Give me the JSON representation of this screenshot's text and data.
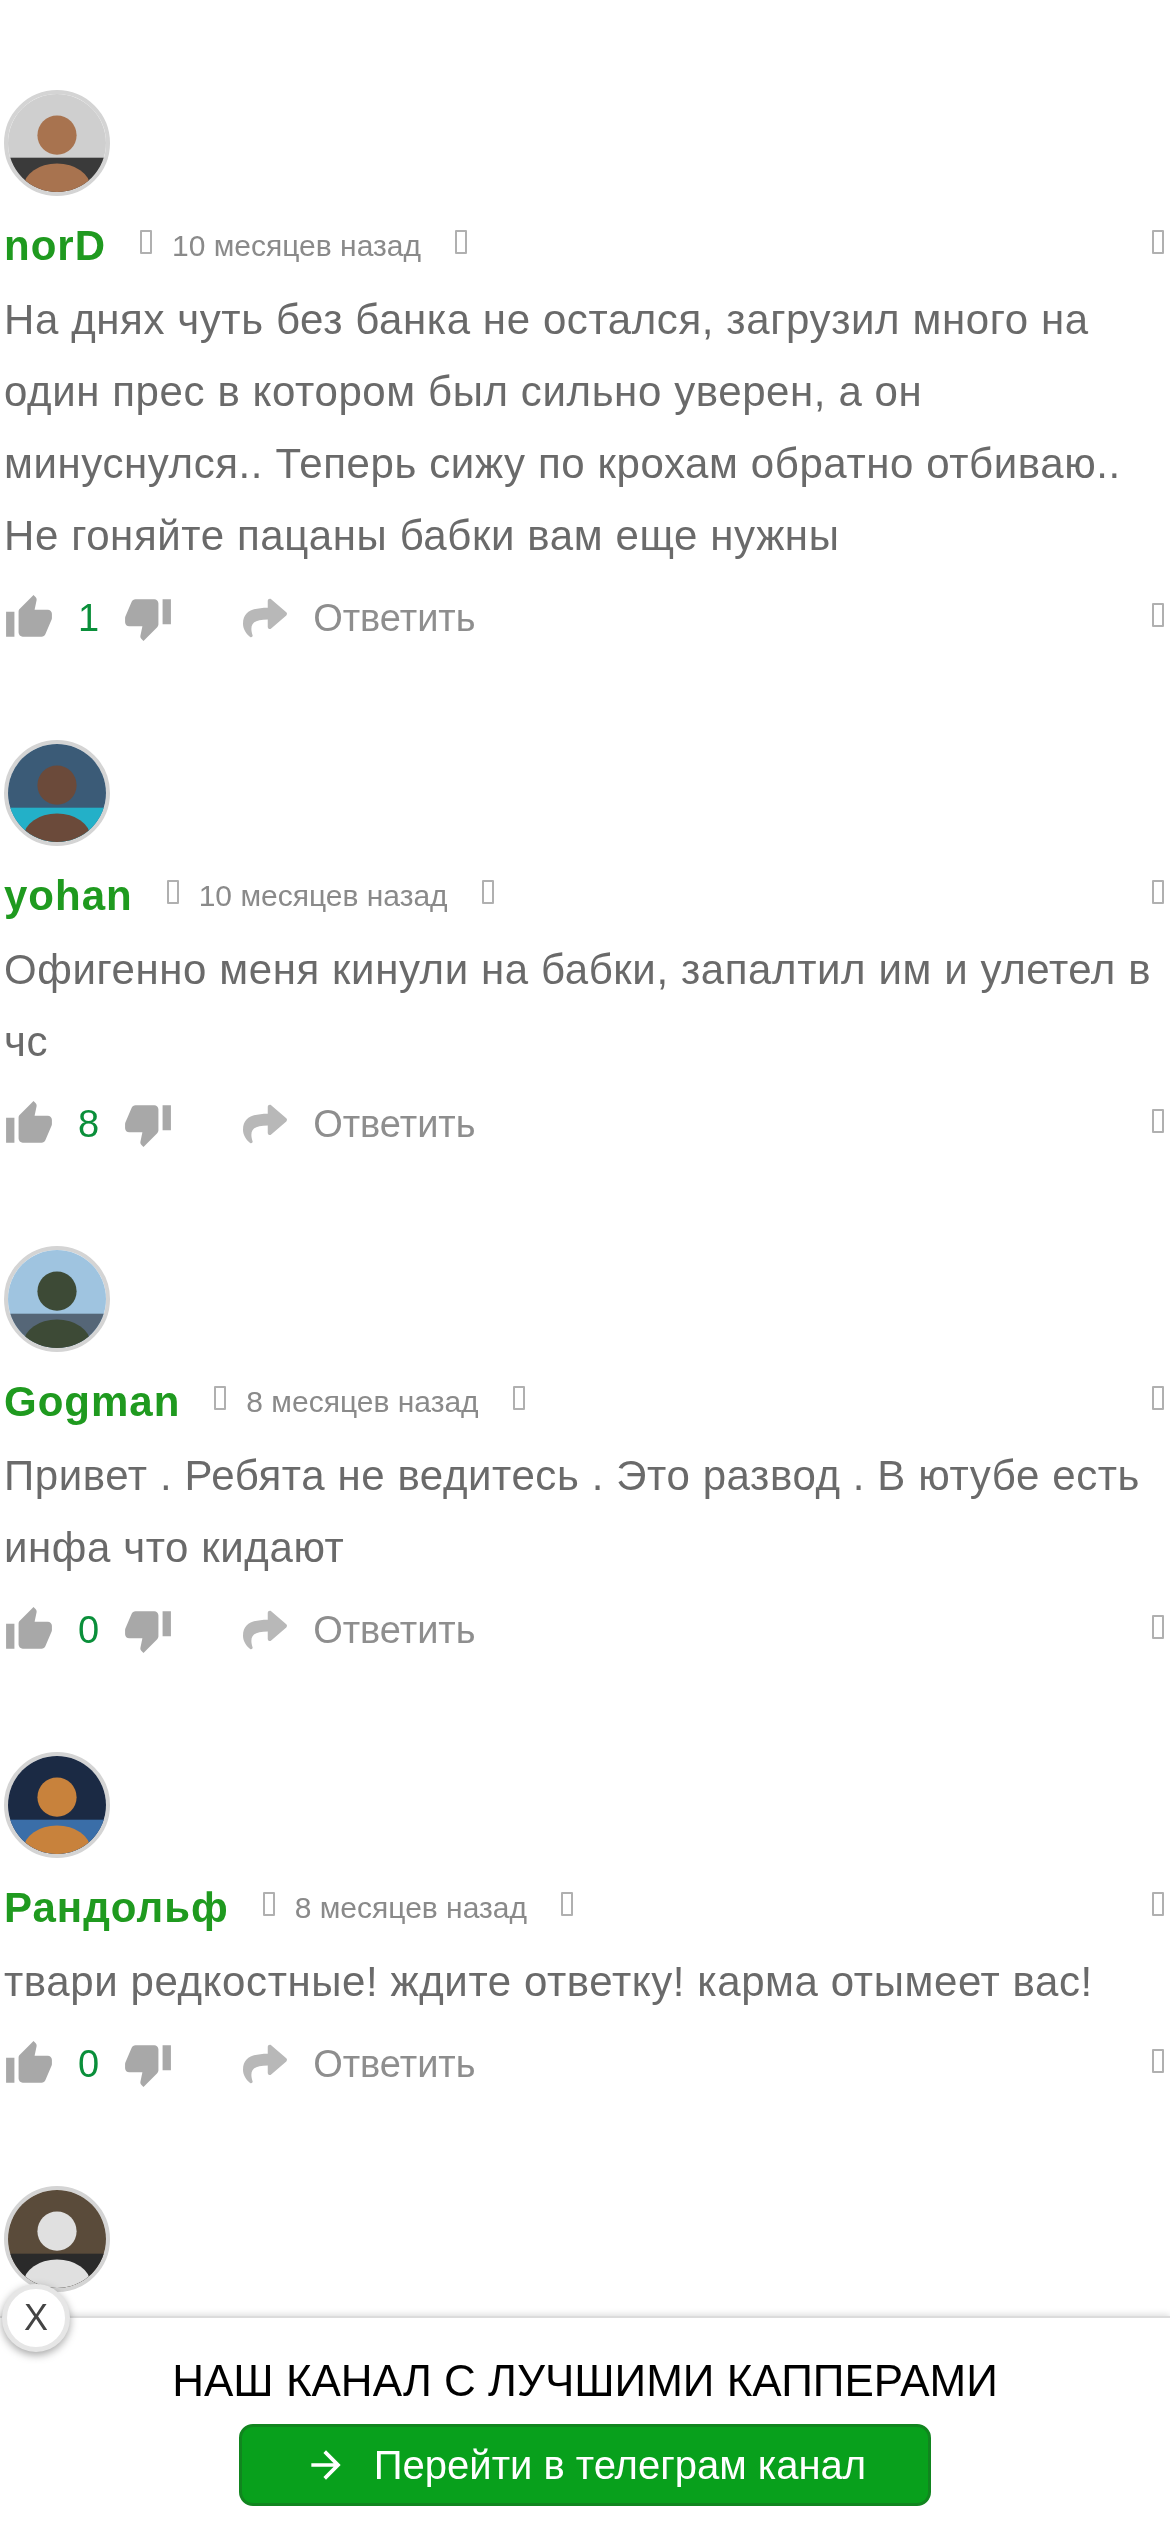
{
  "comments": [
    {
      "author": "norD",
      "time": "10 месяцев назад",
      "text": "На днях чуть без банка не остался, загрузил много на один прес в котором был сильно уверен, а он минуснулся.. Теперь сижу по крохам обратно отбиваю.. Не гоняйте пацаны бабки вам еще нужны",
      "likes": "1",
      "reply": "Ответить"
    },
    {
      "author": "yohan",
      "time": "10 месяцев назад",
      "text": "Офигенно меня кинули на бабки, запалтил им и улетел в чс",
      "likes": "8",
      "reply": "Ответить"
    },
    {
      "author": "Gogman",
      "time": "8 месяцев назад",
      "text": "Привет . Ребята не ведитесь . Это развод . В ютубе есть инфа что кидают",
      "likes": "0",
      "reply": "Ответить"
    },
    {
      "author": "Рандольф",
      "time": "8 месяцев назад",
      "text": "твари редкостные! ждите ответку! карма отымеет вас!",
      "likes": "0",
      "reply": "Ответить"
    }
  ],
  "banner": {
    "close": "X",
    "title": "НАШ КАНАЛ С ЛУЧШИМИ КАППЕРАМИ",
    "button": "Перейти в телеграм канал"
  }
}
